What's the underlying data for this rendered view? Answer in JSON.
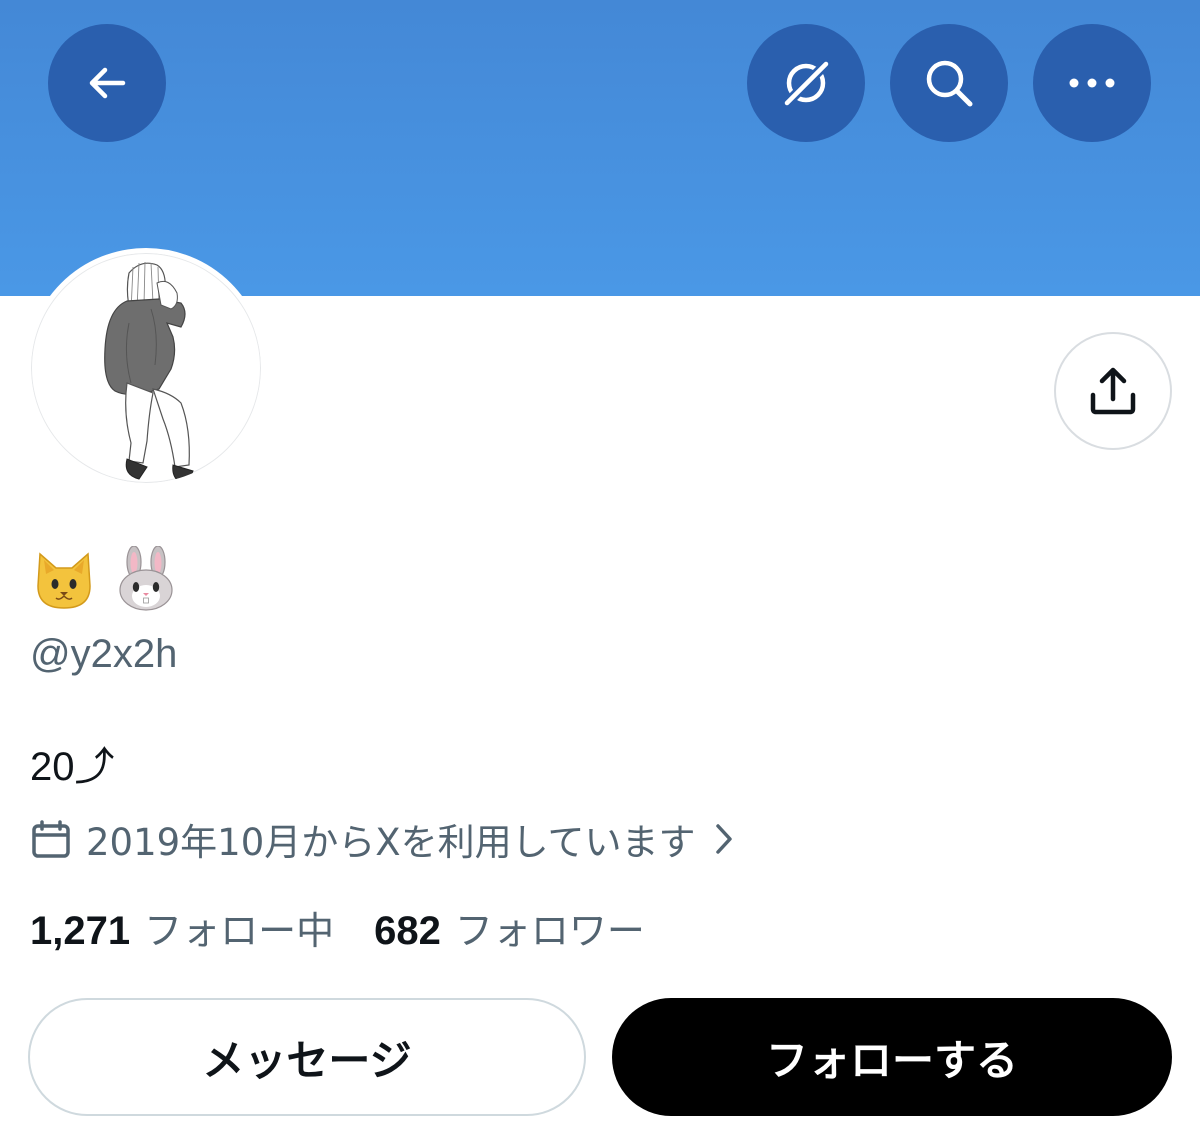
{
  "header": {
    "back_icon": "arrow-left-icon",
    "grok_icon": "grok-icon",
    "search_icon": "search-icon",
    "more_icon": "more-horizontal-icon",
    "banner_color": "#4a92e0",
    "button_color": "#2a5fae"
  },
  "profile": {
    "avatar_icon": "avatar-illustration",
    "share_icon": "share-icon",
    "display_name_emojis": [
      "cat-face-emoji",
      "rabbit-face-emoji"
    ],
    "handle": "@y2x2h",
    "bio": "20⤴",
    "joined_icon": "calendar-icon",
    "joined_text": "2019年10月からXを利用しています",
    "joined_chevron": "chevron-right-icon"
  },
  "stats": {
    "following_count": "1,271",
    "following_label": "フォロー中",
    "followers_count": "682",
    "followers_label": "フォロワー"
  },
  "actions": {
    "message_label": "メッセージ",
    "follow_label": "フォローする"
  }
}
